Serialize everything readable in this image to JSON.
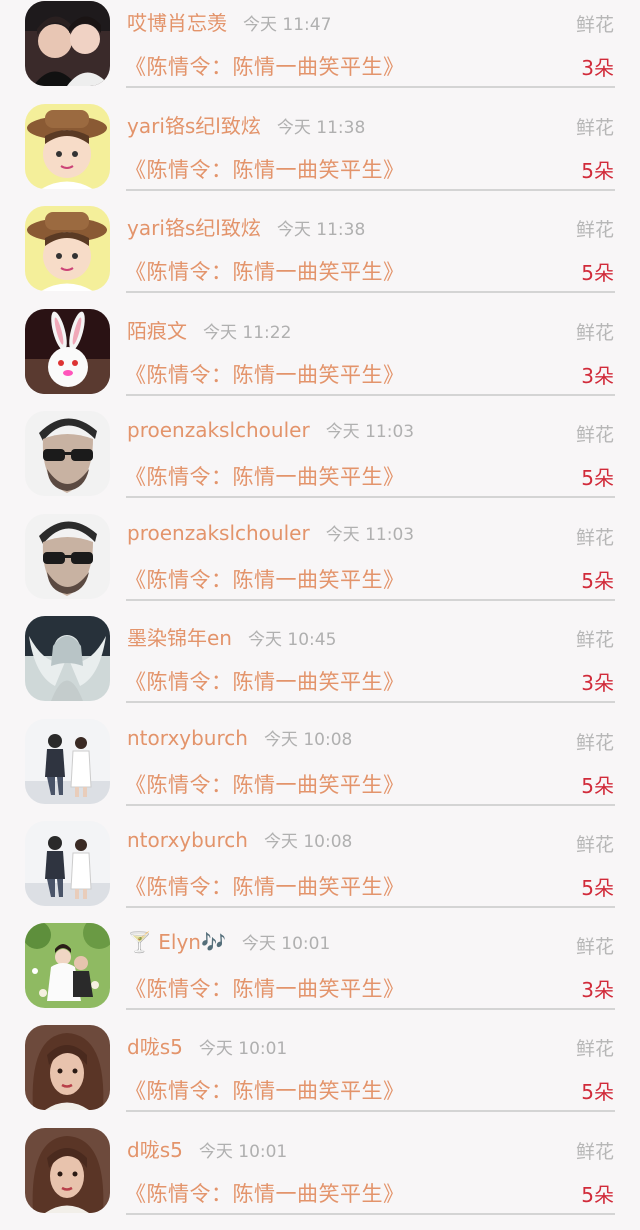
{
  "records": [
    {
      "name": "哎博肖忘羡",
      "time": "今天 11:47",
      "gift": "鲜花",
      "book": "《陈情令：陈情一曲笑平生》",
      "count": "3朵",
      "avatar": "couple-photo-avatar"
    },
    {
      "name": "yari铬s纪l致炫",
      "time": "今天 11:38",
      "gift": "鲜花",
      "book": "《陈情令：陈情一曲笑平生》",
      "count": "5朵",
      "avatar": "kid-straw-hat-avatar"
    },
    {
      "name": "yari铬s纪l致炫",
      "time": "今天 11:38",
      "gift": "鲜花",
      "book": "《陈情令：陈情一曲笑平生》",
      "count": "5朵",
      "avatar": "kid-straw-hat-avatar"
    },
    {
      "name": "陌痕文",
      "time": "今天 11:22",
      "gift": "鲜花",
      "book": "《陈情令：陈情一曲笑平生》",
      "count": "3朵",
      "avatar": "white-rabbit-avatar"
    },
    {
      "name": "proenzakslchouler",
      "time": "今天 11:03",
      "gift": "鲜花",
      "book": "《陈情令：陈情一曲笑平生》",
      "count": "5朵",
      "avatar": "man-sunglasses-avatar"
    },
    {
      "name": "proenzakslchouler",
      "time": "今天 11:03",
      "gift": "鲜花",
      "book": "《陈情令：陈情一曲笑平生》",
      "count": "5朵",
      "avatar": "man-sunglasses-avatar"
    },
    {
      "name": "墨染锦年en",
      "time": "今天 10:45",
      "gift": "鲜花",
      "book": "《陈情令：陈情一曲笑平生》",
      "count": "3朵",
      "avatar": "angel-art-avatar"
    },
    {
      "name": "ntorxyburch",
      "time": "今天 10:08",
      "gift": "鲜花",
      "book": "《陈情令：陈情一曲笑平生》",
      "count": "5朵",
      "avatar": "couple-outdoor-avatar"
    },
    {
      "name": "ntorxyburch",
      "time": "今天 10:08",
      "gift": "鲜花",
      "book": "《陈情令：陈情一曲笑平生》",
      "count": "5朵",
      "avatar": "couple-outdoor-avatar"
    },
    {
      "name": "🍸 Elyn🎶",
      "time": "今天 10:01",
      "gift": "鲜花",
      "book": "《陈情令：陈情一曲笑平生》",
      "count": "3朵",
      "avatar": "garden-couple-avatar"
    },
    {
      "name": "d咙s5",
      "time": "今天 10:01",
      "gift": "鲜花",
      "book": "《陈情令：陈情一曲笑平生》",
      "count": "5朵",
      "avatar": "girl-brown-hair-avatar"
    },
    {
      "name": "d咙s5",
      "time": "今天 10:01",
      "gift": "鲜花",
      "book": "《陈情令：陈情一曲笑平生》",
      "count": "5朵",
      "avatar": "girl-brown-hair-avatar"
    }
  ]
}
